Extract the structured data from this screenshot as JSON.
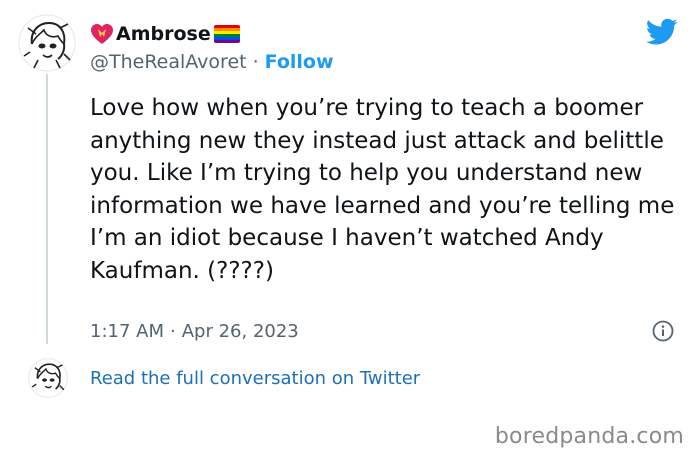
{
  "author": {
    "display_name": "Ambrose",
    "handle": "@TheRealAvoret",
    "separator": "·",
    "follow_label": "Follow",
    "name_prefix_icon": "heart-with-ribbon-emoji",
    "name_suffix_icon": "rainbow-flag-emoji",
    "avatar_icon": "anime-sketch-avatar"
  },
  "tweet": {
    "text": "Love how when you’re trying to teach a boomer anything new they instead just attack and belittle you. Like I’m trying to help you understand new information we have learned and you’re telling me I’m an idiot because I haven’t watched Andy Kaufman. (????)",
    "time": "1:17 AM",
    "date": "Apr 26, 2023",
    "separator": "·"
  },
  "footer": {
    "read_link": "Read the full conversation on Twitter"
  },
  "brand": {
    "logo_icon": "twitter-bird-icon",
    "logo_color": "#1d9bf0",
    "link_color": "#1d9bf0",
    "watermark": "boredpanda.com"
  }
}
